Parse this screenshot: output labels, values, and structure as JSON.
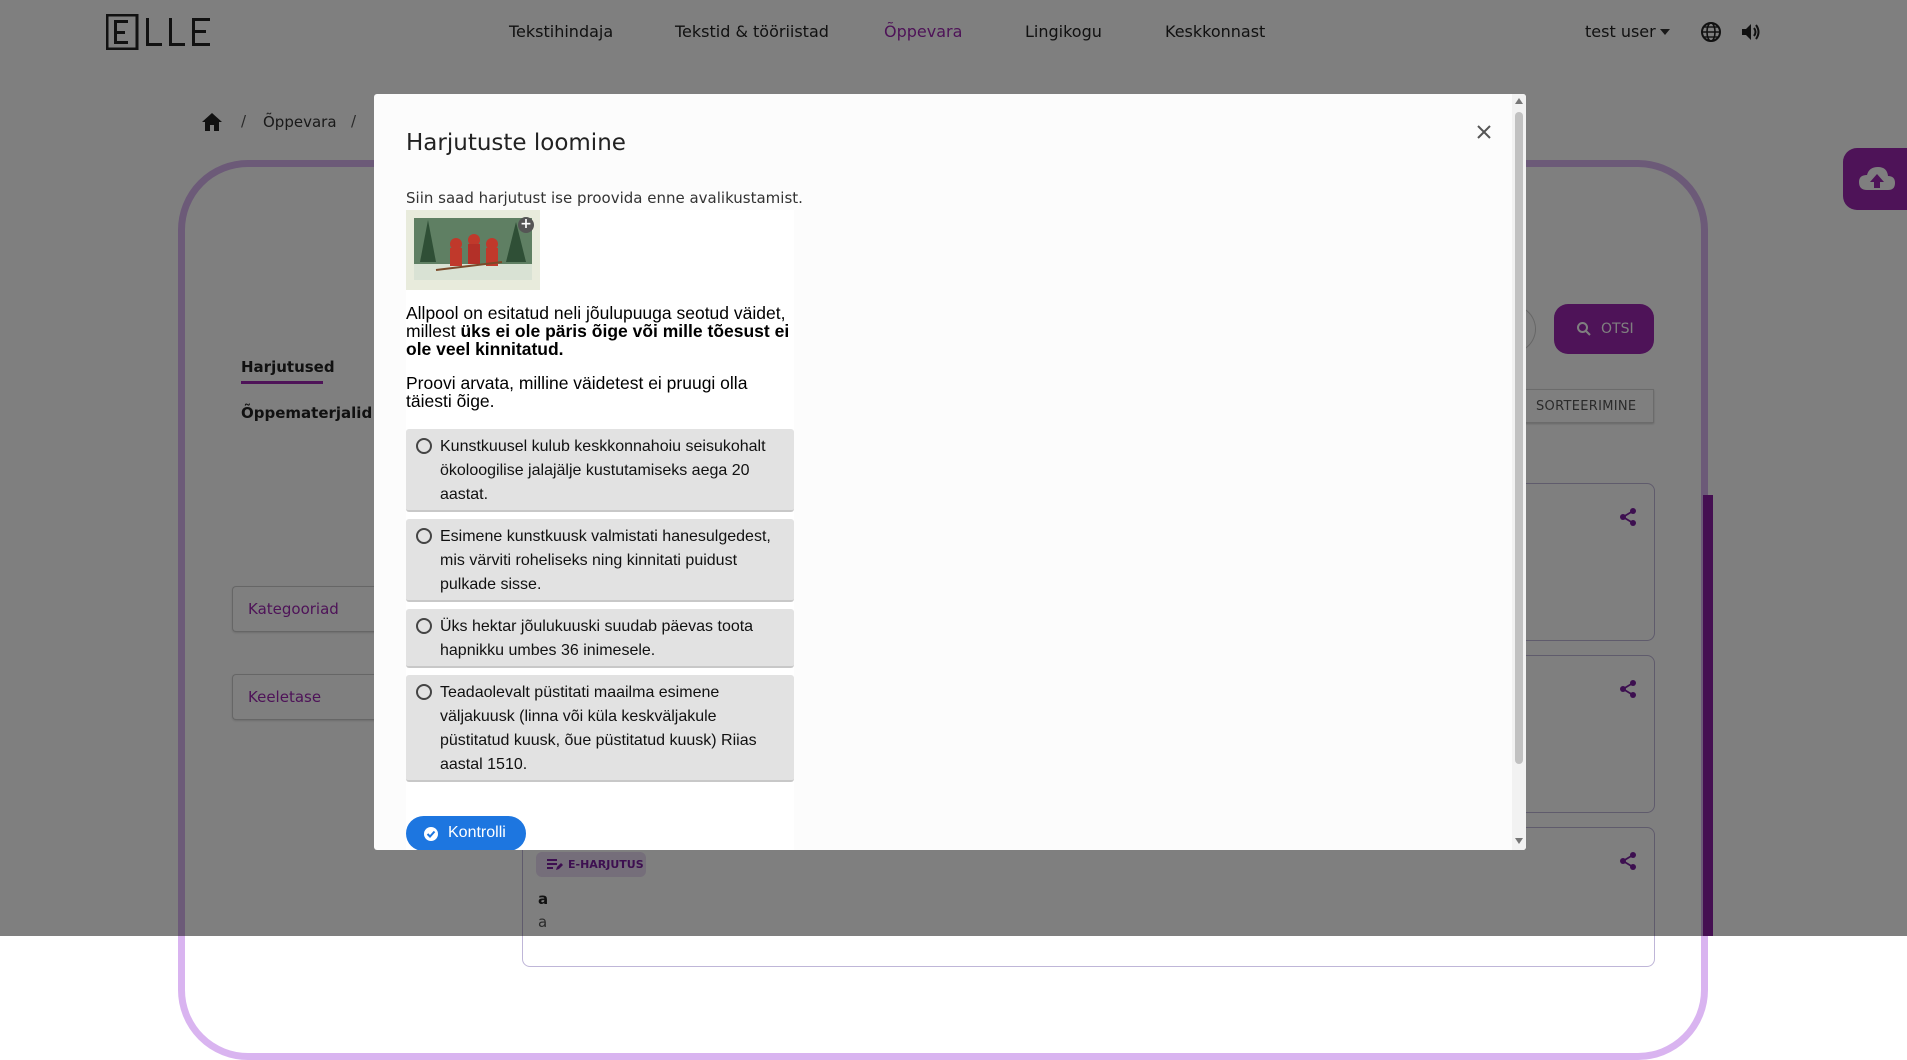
{
  "header": {
    "nav": [
      "Tekstihindaja",
      "Tekstid & tööriistad",
      "Õppevara",
      "Lingikogu",
      "Keskkonnast"
    ],
    "active_nav": "Õppevara",
    "user": "test user",
    "logo_icon": "elle-logo",
    "globe_icon": "globe-icon",
    "speaker_icon": "speaker-icon"
  },
  "breadcrumb": {
    "home_icon": "home-icon",
    "separator": "/",
    "items": [
      "Õppevara"
    ]
  },
  "page": {
    "tabs": [
      "Harjutused",
      "Õppematerjalid"
    ],
    "active_tab": "Harjutused",
    "filters": [
      "Kategooriad",
      "Keeletase"
    ],
    "search_button": "OTSI",
    "sort_button": "SORTEERIMINE",
    "chip_label": "E-HARJUTUS",
    "card_title": "a",
    "card_subtitle": "a",
    "accent_color": "#9c27b0"
  },
  "modal": {
    "title": "Harjutuste loomine",
    "close_icon": "close-icon",
    "intro": "Siin saad harjutust ise proovida enne avalikustamist.",
    "question_part1": "Allpool on esitatud neli jõulupuuga seotud väidet, millest ",
    "question_bold": "üks ei ole päris õige või mille tõesust ei ole veel kinnitatud.",
    "question_part2": "Proovi arvata, milline väidetest ei pruugi olla täiesti õige.",
    "options": [
      "Kunstkuusel kulub keskkonnahoiu seisukohalt ökoloogilise jalajälje kustutamiseks aega 20 aastat.",
      "Esimene kunstkuusk valmistati hanesulgedest, mis värviti roheliseks ning kinnitati puidust pulkade sisse.",
      "Üks hektar jõulukuuski suudab päevas toota hapnikku umbes 36 inimesele.",
      "Teadaolevalt püstitati maailma esimene väljakuusk (linna või küla keskväljakule püstitatud kuusk, õue püstitatud kuusk) Riias aastal 1510."
    ],
    "check_button": "Kontrolli",
    "check_color": "#1d76e0"
  }
}
